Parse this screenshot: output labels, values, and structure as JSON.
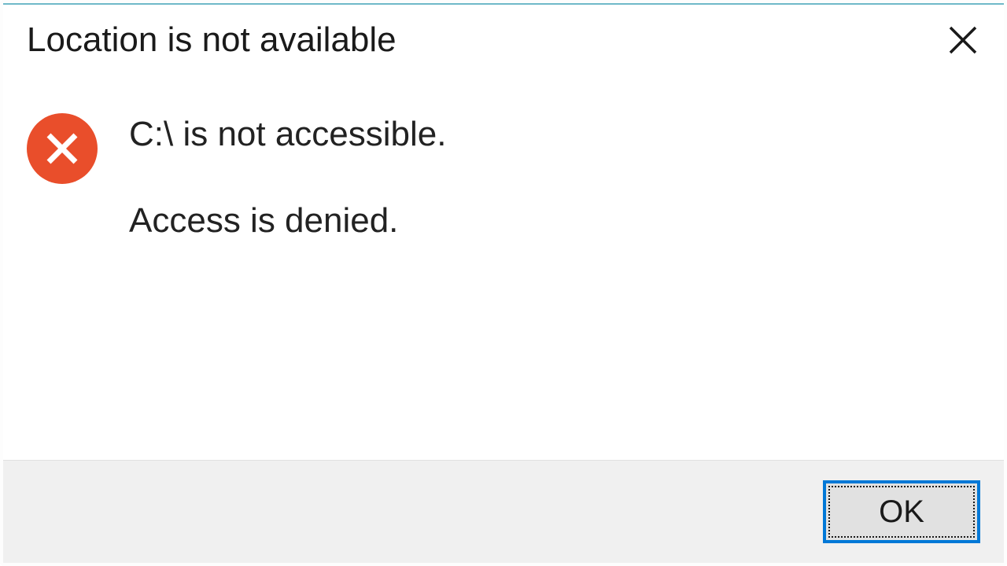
{
  "dialog": {
    "title": "Location is not available",
    "message_line1": "C:\\ is not accessible.",
    "message_line2": "Access is denied.",
    "ok_label": "OK"
  },
  "icons": {
    "close": "close-icon",
    "error": "error-circle-x-icon"
  },
  "colors": {
    "accent_border": "#6fb9c9",
    "error_red": "#e94e2b",
    "focus_blue": "#0078d7",
    "button_bg": "#e1e1e1",
    "footer_bg": "#f0f0f0"
  }
}
